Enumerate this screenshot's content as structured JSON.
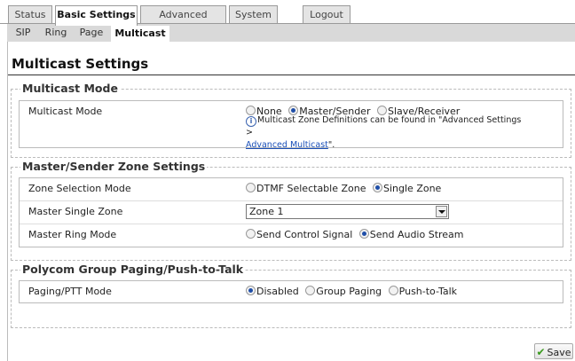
{
  "top_tabs": [
    "Status",
    "Basic Settings",
    "Advanced Settings",
    "System",
    "Logout"
  ],
  "sub_tabs": [
    "SIP",
    "Ring",
    "Page",
    "Multicast"
  ],
  "page_title": "Multicast Settings",
  "multicast_mode": {
    "legend": "Multicast Mode",
    "label": "Multicast Mode",
    "options": [
      "None",
      "Master/Sender",
      "Slave/Receiver"
    ],
    "selected": "Master/Sender",
    "note_text": "Multicast Zone Definitions can be found in \"Advanced Settings >",
    "note_link": "Advanced Multicast",
    "note_end": "\"."
  },
  "zone_settings": {
    "legend": "Master/Sender Zone Settings",
    "zone_selection_label": "Zone Selection Mode",
    "zone_selection_options": [
      "DTMF Selectable Zone",
      "Single Zone"
    ],
    "zone_selection_selected": "Single Zone",
    "master_single_zone_label": "Master Single Zone",
    "master_single_zone_value": "Zone 1",
    "master_ring_mode_label": "Master Ring Mode",
    "master_ring_mode_options": [
      "Send Control Signal",
      "Send Audio Stream"
    ],
    "master_ring_mode_selected": "Send Audio Stream"
  },
  "paging": {
    "legend": "Polycom Group Paging/Push-to-Talk",
    "label": "Paging/PTT Mode",
    "options": [
      "Disabled",
      "Group Paging",
      "Push-to-Talk"
    ],
    "selected": "Disabled"
  },
  "save_label": "Save",
  "colors": {
    "link": "#1a4fb8",
    "radio_checked": "#1f4ea8",
    "save_check": "#3a9a1e"
  }
}
